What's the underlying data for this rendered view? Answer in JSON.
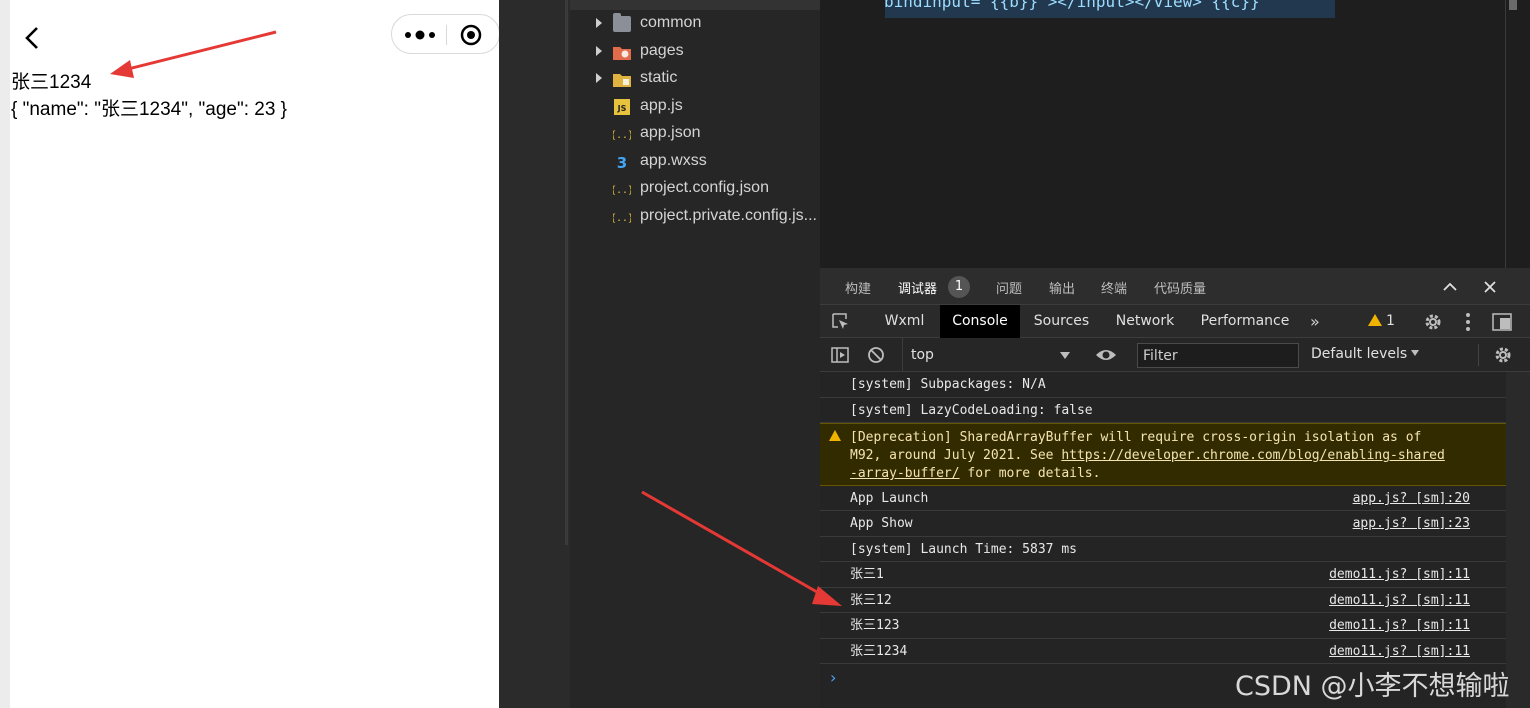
{
  "simulator": {
    "line1": "张三1234",
    "line2": "{ \"name\": \"张三1234\", \"age\": 23 }"
  },
  "file_tree": {
    "items": [
      {
        "name": "common",
        "type": "folder",
        "icon": "folder-icon"
      },
      {
        "name": "pages",
        "type": "folder",
        "icon": "folder-pages-icon"
      },
      {
        "name": "static",
        "type": "folder",
        "icon": "folder-static-icon"
      },
      {
        "name": "app.js",
        "type": "file",
        "icon": "js-file-icon"
      },
      {
        "name": "app.json",
        "type": "file",
        "icon": "json-file-icon"
      },
      {
        "name": "app.wxss",
        "type": "file",
        "icon": "css-file-icon"
      },
      {
        "name": "project.config.json",
        "type": "file",
        "icon": "json-file-icon"
      },
      {
        "name": "project.private.config.js...",
        "type": "file",
        "icon": "json-file-icon"
      }
    ]
  },
  "editor": {
    "code_line": "bindinput=\"{{b}}\"></input></view> {{c}}"
  },
  "panel_tabs": {
    "build": "构建",
    "debugger": "调试器",
    "debugger_badge": "1",
    "problems": "问题",
    "output": "输出",
    "terminal": "终端",
    "quality": "代码质量"
  },
  "devtools_tabs": {
    "wxml": "Wxml",
    "console": "Console",
    "sources": "Sources",
    "network": "Network",
    "performance": "Performance",
    "more": "»",
    "warning_count": "1"
  },
  "console_bar": {
    "context": "top",
    "filter_placeholder": "Filter",
    "levels": "Default levels"
  },
  "console": {
    "messages": [
      {
        "text": "[system] Subpackages: N/A",
        "source": ""
      },
      {
        "text": "[system] LazyCodeLoading: false",
        "source": ""
      },
      {
        "text": "App Launch",
        "source": "app.js? [sm]:20"
      },
      {
        "text": "App Show",
        "source": "app.js? [sm]:23"
      },
      {
        "text": "[system] Launch Time: 5837 ms",
        "source": ""
      },
      {
        "text": "张三1",
        "source": "demo11.js? [sm]:11"
      },
      {
        "text": "张三12",
        "source": "demo11.js? [sm]:11"
      },
      {
        "text": "张三123",
        "source": "demo11.js? [sm]:11"
      },
      {
        "text": "张三1234",
        "source": "demo11.js? [sm]:11"
      }
    ],
    "warning": {
      "line1": "[Deprecation] SharedArrayBuffer will require cross-origin isolation as of",
      "line2_pre": "M92, around July 2021. See ",
      "line2_link": "https://developer.chrome.com/blog/enabling-shared",
      "line3_link": "-array-buffer/",
      "line3_post": " for more details."
    },
    "prompt": "›"
  },
  "watermark": "CSDN @小李不想输啦",
  "colors": {
    "annotation_arrow": "#e53935",
    "warning_bg": "#332b00",
    "warning_icon": "#f0b400",
    "console_tab_bg": "#000000"
  }
}
